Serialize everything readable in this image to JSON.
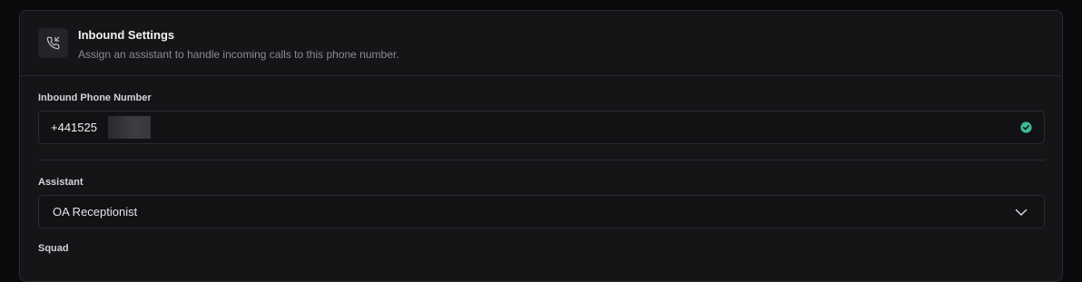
{
  "header": {
    "title": "Inbound Settings",
    "subtitle": "Assign an assistant to handle incoming calls to this phone number.",
    "icon": "phone-incoming-icon"
  },
  "phone_field": {
    "label": "Inbound Phone Number",
    "value": "+441525",
    "value_redacted": true,
    "status_icon": "check-circle-icon",
    "status_color": "#3fb99a"
  },
  "assistant_field": {
    "label": "Assistant",
    "selected": "OA Receptionist",
    "icon": "chevron-down-icon"
  },
  "next_section": {
    "label": "Squad"
  }
}
